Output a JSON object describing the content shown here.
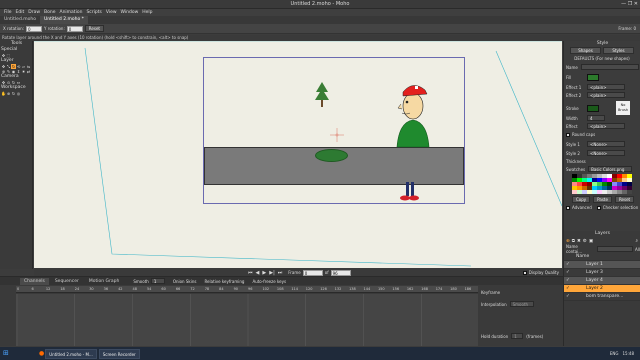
{
  "window": {
    "title": "Untitled 2.moho - Moho"
  },
  "menu": [
    "File",
    "Edit",
    "Draw",
    "Bone",
    "Animation",
    "Scripts",
    "View",
    "Window",
    "Help"
  ],
  "tabs": [
    "Untitled.moho",
    "Untitled 2.moho *"
  ],
  "options": {
    "x_rotation_label": "X rotation:",
    "x_rotation_value": "0",
    "y_rotation_label": "Y rotation:",
    "y_rotation_value": "0",
    "reset_label": "Reset",
    "frame_label": "Frame: 0"
  },
  "hint": "Rotate layer around the X and Y axes (10 rotation) (hold <shift> to constrain, <alt> to snap)",
  "tools": {
    "title": "Tools",
    "sections": [
      "Special",
      "Layer",
      "Camera",
      "Workspace"
    ]
  },
  "style_panel": {
    "title": "Style",
    "shapes_tab": "Shapes",
    "styles_tab": "Styles",
    "defaults": "DEFAULTS (For new shapes)",
    "name_label": "Name",
    "fill_label": "Fill",
    "stroke_label": "Stroke",
    "effect1_label": "Effect 1",
    "effect2_label": "Effect 2",
    "effect_value": "<plain>",
    "width_label": "Width",
    "width_value": "4",
    "no_brush": "No Brush",
    "effect_label": "Effect",
    "round_caps": "Round caps",
    "style1_label": "Style 1",
    "style2_label": "Style 2",
    "style_value": "<None>",
    "thickness_label": "Thickness",
    "swatches_label": "Swatches",
    "swatches_value": "Basic Colors.png",
    "copy": "Copy",
    "paste": "Paste",
    "reset": "Reset",
    "advanced": "Advanced",
    "checker": "Checker selection",
    "fill_color": "#2c7a2c",
    "stroke_color": "#1a5a1a"
  },
  "layers_panel": {
    "title": "Layers",
    "name_contains": "Name contai...",
    "all": "All",
    "name_header": "Name",
    "rows": [
      {
        "name": "Layer 1",
        "kind": "grp"
      },
      {
        "name": "Layer 3",
        "kind": "normal"
      },
      {
        "name": "Layer 4",
        "kind": "grp"
      },
      {
        "name": "Layer 2",
        "kind": "sel"
      },
      {
        "name": "bom transpare...",
        "kind": "normal"
      }
    ]
  },
  "timeline": {
    "tabs": [
      "Channels",
      "Sequencer",
      "Motion Graph"
    ],
    "smooth_label": "Smooth",
    "smooth_value": "1",
    "onion_skins": "Onion Skins",
    "relative_keyframing": "Relative keyframing",
    "auto_freeze": "Auto-freeze keys",
    "frame_label": "Frame",
    "frame_value": "0",
    "of_label": "of",
    "of_value": "96",
    "display_quality": "Display Quality",
    "ticks": [
      "0",
      "6",
      "12",
      "18",
      "24",
      "30",
      "36",
      "42",
      "48",
      "54",
      "60",
      "66",
      "72",
      "78",
      "84",
      "90",
      "96",
      "102",
      "108",
      "114",
      "120",
      "126",
      "132",
      "138",
      "144",
      "150",
      "156",
      "162",
      "168",
      "174",
      "180",
      "186"
    ],
    "keyframe_label": "Keyframe",
    "interpolation_label": "Interpolation",
    "interpolation_value": "Smooth",
    "hold_duration_label": "Hold duration",
    "hold_duration_value": "1",
    "frames_label": "(frames)"
  },
  "taskbar": {
    "items": [
      "Untitled 2.moho - M...",
      "Screen Recorder"
    ],
    "lang": "ENG",
    "time": "15:48"
  }
}
